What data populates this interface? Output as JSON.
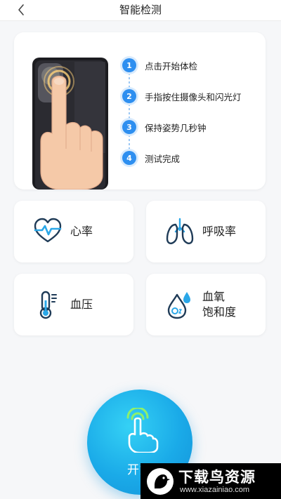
{
  "header": {
    "title": "智能检测",
    "back_icon": "chevron-left-icon"
  },
  "guide": {
    "steps": [
      {
        "num": "1",
        "text": "点击开始体检"
      },
      {
        "num": "2",
        "text": "手指按住摄像头和闪光灯"
      },
      {
        "num": "3",
        "text": "保持姿势几秒钟"
      },
      {
        "num": "4",
        "text": "测试完成"
      }
    ]
  },
  "tiles": [
    {
      "label": "心率",
      "icon": "heart-rate-icon"
    },
    {
      "label": "呼吸率",
      "icon": "lungs-icon"
    },
    {
      "label": "血压",
      "icon": "thermometer-icon"
    },
    {
      "label_line1": "血氧",
      "label_line2": "饱和度",
      "icon": "oxygen-drop-icon"
    }
  ],
  "start_button": {
    "label": "开始",
    "icon": "finger-tap-icon"
  },
  "watermark": {
    "title": "下载鸟资源",
    "subtitle": "www.xiazainiao.com"
  },
  "colors": {
    "accent": "#2e8ff0",
    "start_gradient_light": "#35d1f5",
    "start_gradient_dark": "#1492d8",
    "background": "#f6f7f9",
    "icon_dark": "#1f3b57",
    "icon_blue": "#2aa7e8"
  }
}
